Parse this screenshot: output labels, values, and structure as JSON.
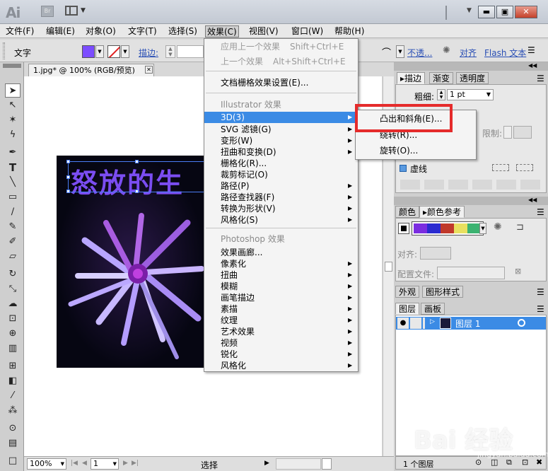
{
  "menubar": {
    "items": [
      "文件(F)",
      "编辑(E)",
      "对象(O)",
      "文字(T)",
      "选择(S)",
      "效果(C)",
      "视图(V)",
      "窗口(W)",
      "帮助(H)"
    ]
  },
  "control_bar": {
    "tool_label": "文字",
    "stroke_label": "描边:",
    "opacity_label": "不透...",
    "align_label": "对齐",
    "flash_label": "Flash 文本"
  },
  "document": {
    "tab_title": "1.jpg* @ 100% (RGB/预览)",
    "art_text": "怒放的生"
  },
  "effect_menu": {
    "apply_last": {
      "label": "应用上一个效果",
      "shortcut": "Shift+Ctrl+E"
    },
    "last_effect": {
      "label": "上一个效果",
      "shortcut": "Alt+Shift+Ctrl+E"
    },
    "doc_raster": "文档栅格效果设置(E)...",
    "illustrator_header": "Illustrator 效果",
    "illustrator_items": [
      "3D(3)",
      "SVG 滤镜(G)",
      "变形(W)",
      "扭曲和变换(D)",
      "栅格化(R)...",
      "裁剪标记(O)",
      "路径(P)",
      "路径查找器(F)",
      "转换为形状(V)",
      "风格化(S)"
    ],
    "photoshop_header": "Photoshop 效果",
    "photoshop_items": [
      "效果画廊...",
      "像素化",
      "扭曲",
      "模糊",
      "画笔描边",
      "素描",
      "纹理",
      "艺术效果",
      "视频",
      "锐化",
      "风格化"
    ]
  },
  "submenu_3d": {
    "items": [
      "凸出和斜角(E)...",
      "绕转(R)...",
      "旋转(O)..."
    ]
  },
  "stroke_panel": {
    "tabs": [
      "描边",
      "渐变",
      "透明度"
    ],
    "weight_label": "粗细:",
    "weight_value": "1 pt",
    "limit_label": "限制:",
    "dashed_label": "虚线"
  },
  "color_panel": {
    "tabs": [
      "颜色",
      "颜色参考"
    ],
    "align_label": "对齐:",
    "profile_label": "配置文件:",
    "swatches": [
      "#7b2de0",
      "#2b2bd0",
      "#c0392b",
      "#e8e060",
      "#3cb371"
    ]
  },
  "appearance_panel": {
    "tabs": [
      "外观",
      "图形样式"
    ]
  },
  "layers_panel": {
    "tabs": [
      "图层",
      "画板"
    ],
    "layer_name": "图层 1",
    "footer": "1 个图层"
  },
  "status_bar": {
    "zoom": "100%",
    "page": "1",
    "mode": "选择"
  },
  "watermark": {
    "text": "Bai 经验",
    "url": "jingyan.baidu.com"
  }
}
